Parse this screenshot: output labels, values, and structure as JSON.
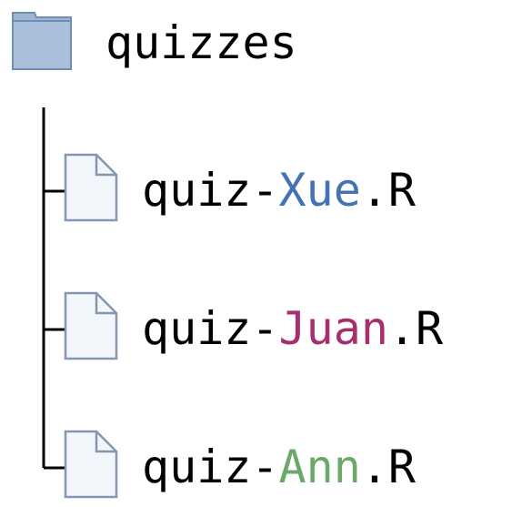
{
  "folder": {
    "name": "quizzes",
    "icon": "folder-icon",
    "icon_fill": "#9db5d3",
    "icon_stroke": "#6f8eb3"
  },
  "files": [
    {
      "prefix": "quiz-",
      "name": "Xue",
      "suffix": ".R",
      "name_color": "#4472b4",
      "icon": "file-icon"
    },
    {
      "prefix": "quiz-",
      "name": "Juan",
      "suffix": ".R",
      "name_color": "#a6306f",
      "icon": "file-icon"
    },
    {
      "prefix": "quiz-",
      "name": "Ann",
      "suffix": ".R",
      "name_color": "#6aa96a",
      "icon": "file-icon"
    }
  ],
  "colors": {
    "text": "#000000",
    "tree_line": "#000000",
    "file_fill": "#f3f6fa",
    "file_stroke": "#8597b0"
  }
}
